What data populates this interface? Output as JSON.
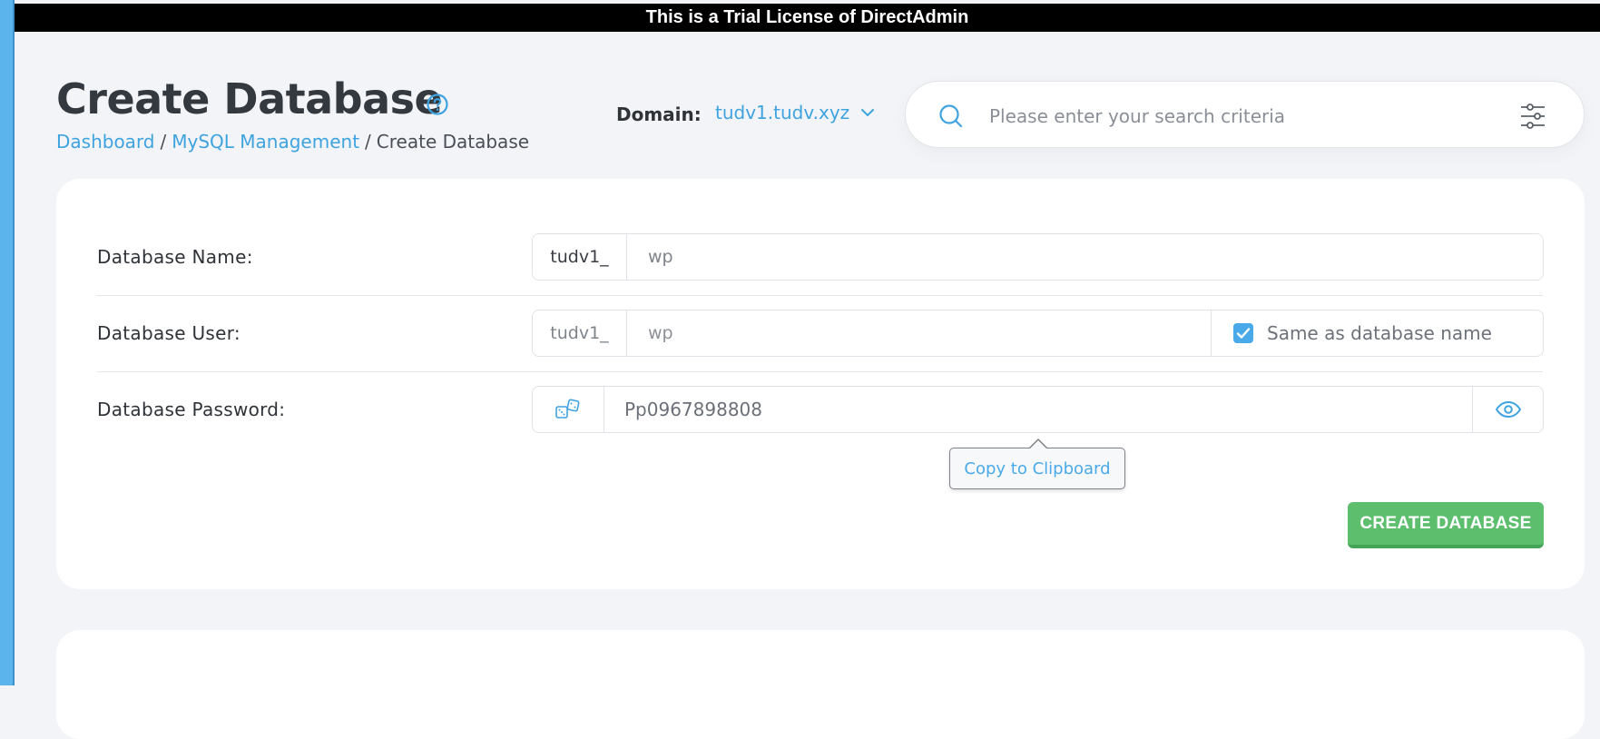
{
  "banner": {
    "text": "This is a Trial License of DirectAdmin"
  },
  "header": {
    "title": "Create Database",
    "breadcrumb": [
      "Dashboard",
      "MySQL Management",
      "Create Database"
    ],
    "breadcrumb_sep": "/",
    "domain_label": "Domain:",
    "domain_value": "tudv1.tudv.xyz",
    "search_placeholder": "Please enter your search criteria"
  },
  "form": {
    "db_name": {
      "label": "Database Name:",
      "prefix": "tudv1_",
      "value": "wp"
    },
    "db_user": {
      "label": "Database User:",
      "prefix": "tudv1_",
      "value": "wp",
      "same_as_label": "Same as database name",
      "same_as_checked": true
    },
    "db_password": {
      "label": "Database Password:",
      "value": "Pp0967898808"
    },
    "tooltip": "Copy to Clipboard",
    "submit_label": "CREATE DATABASE"
  },
  "colors": {
    "accent": "#3fa3e0",
    "success": "#5dbf6e",
    "banner_bg": "#000000",
    "page_bg": "#f2f4f7"
  }
}
